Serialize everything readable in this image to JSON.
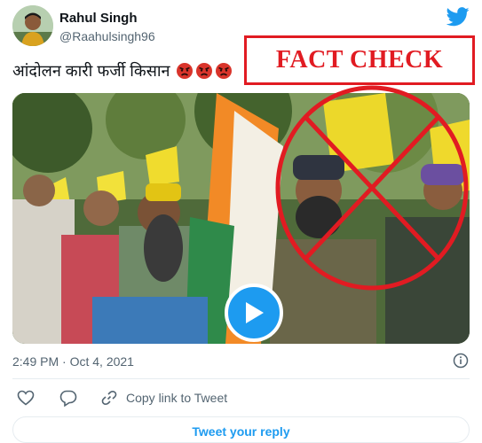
{
  "author": {
    "name": "Rahul Singh",
    "handle": "@Raahulsingh96"
  },
  "overlay": {
    "label": "FACT CHECK"
  },
  "tweet": {
    "text": "आंदोलन कारी फर्जी किसान",
    "emojis": [
      "angry-face",
      "angry-face",
      "angry-face"
    ]
  },
  "media": {
    "type": "video",
    "play_icon": "play-icon"
  },
  "meta": {
    "timestamp": "2:49 PM · Oct 4, 2021"
  },
  "actions": {
    "copy_link_label": "Copy link to Tweet"
  },
  "reply": {
    "label": "Tweet your reply"
  },
  "colors": {
    "accent": "#1d9bf0",
    "fact_check_red": "#e11b22",
    "muted": "#536471"
  }
}
